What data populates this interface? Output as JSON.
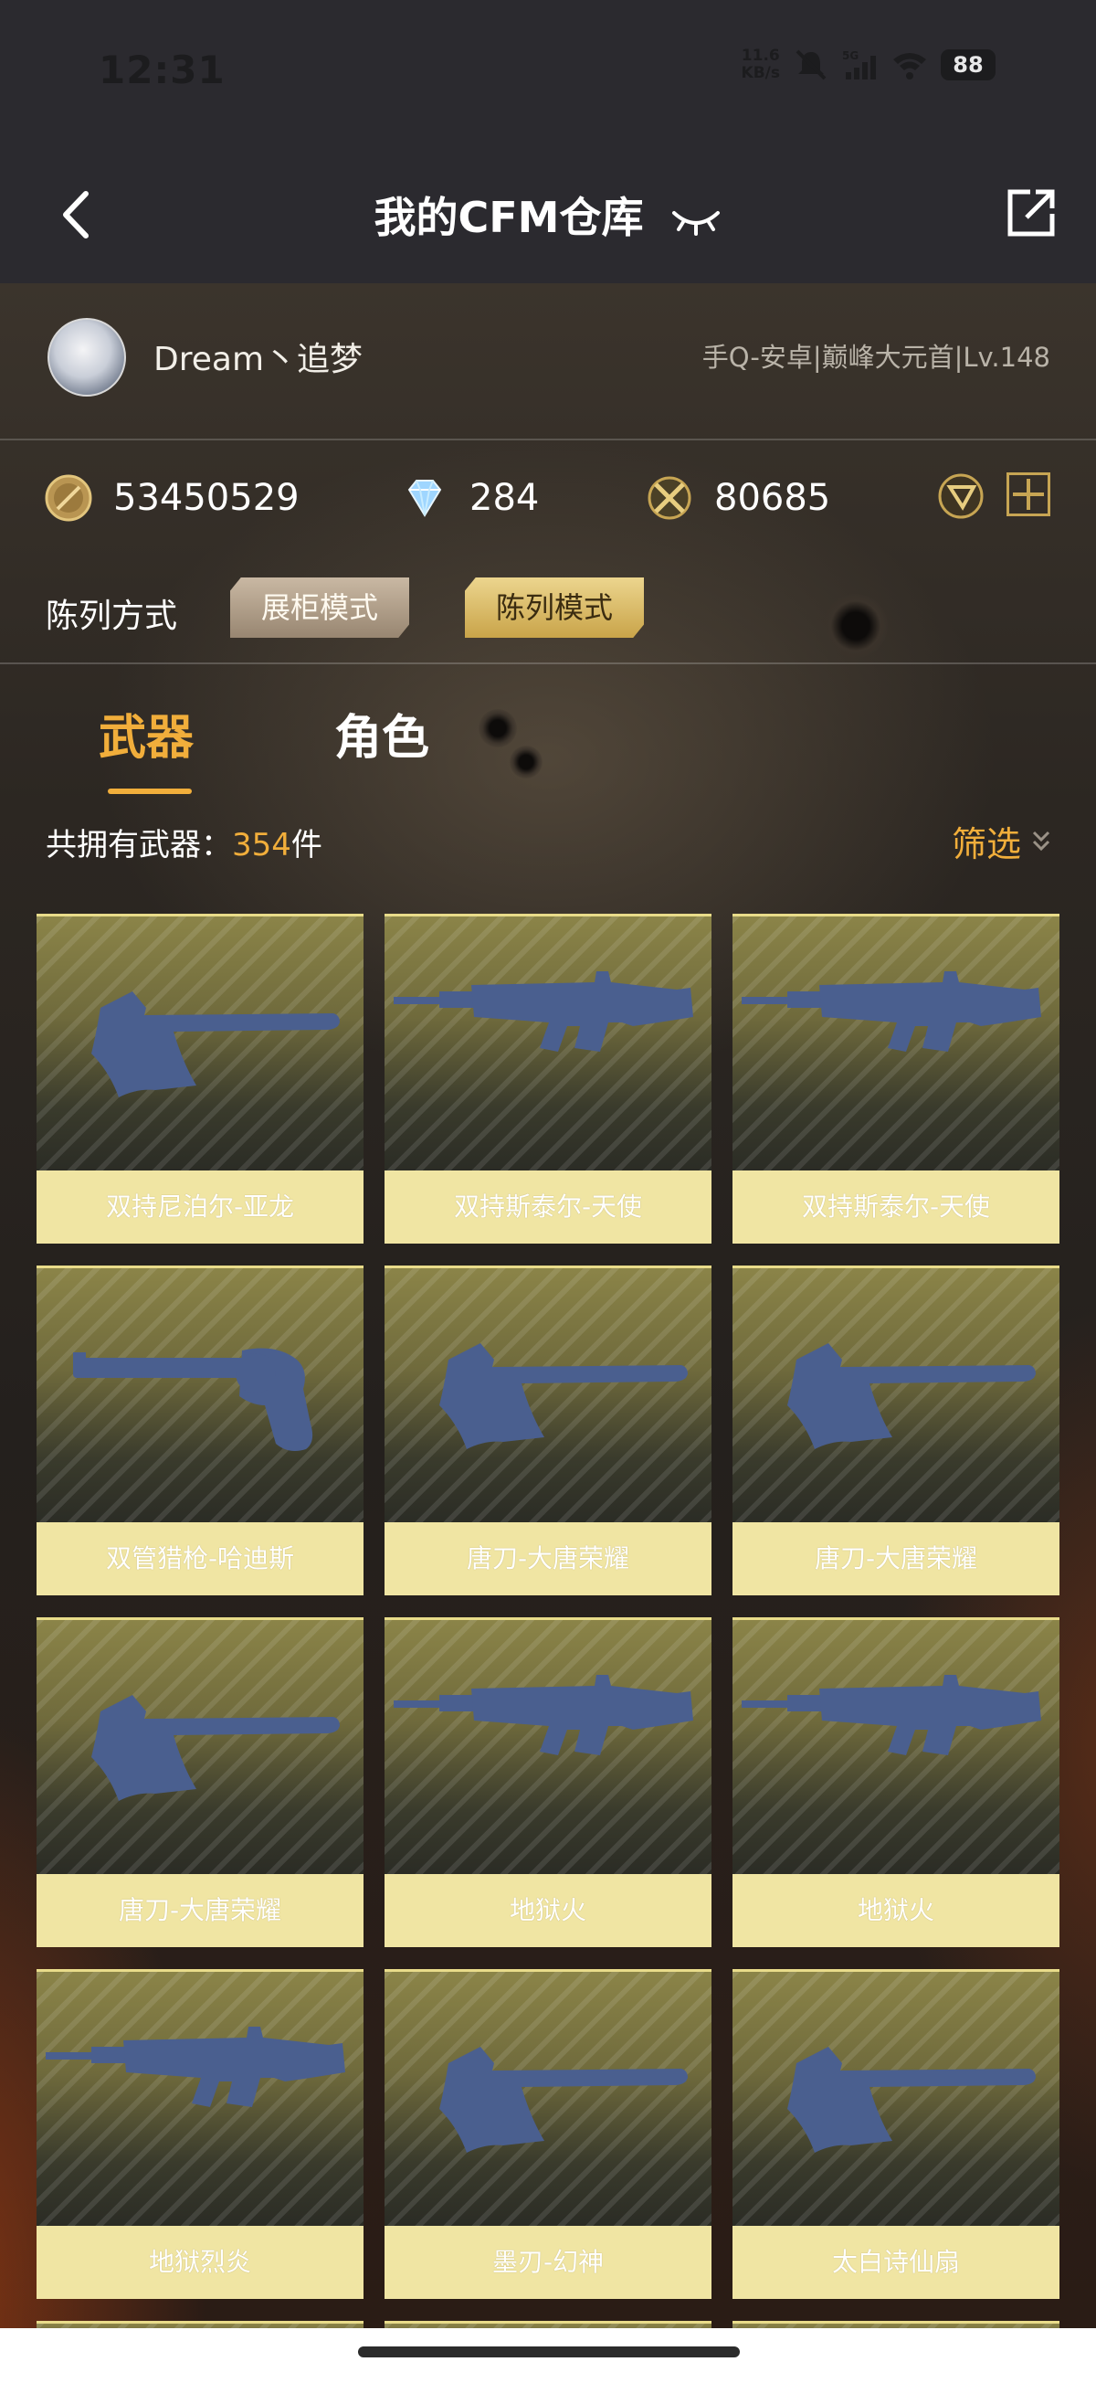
{
  "status_bar": {
    "time": "12:31",
    "net_speed_value": "11.6",
    "net_speed_unit": "KB/s",
    "network": "5G",
    "battery": "88"
  },
  "header": {
    "title": "我的CFM仓库"
  },
  "profile": {
    "username": "Dream丶追梦",
    "server_info": "手Q-安卓|巅峰大元首|Lv.148"
  },
  "currencies": {
    "gold": "53450529",
    "diamond": "284",
    "crossed_swords": "80685"
  },
  "display_mode": {
    "label": "陈列方式",
    "options": [
      "展柜模式",
      "陈列模式"
    ],
    "selected": "陈列模式"
  },
  "tabs": [
    {
      "label": "武器",
      "active": true
    },
    {
      "label": "角色",
      "active": false
    }
  ],
  "inventory": {
    "count_label": "共拥有武器：",
    "count_value": "354",
    "count_unit": "件",
    "filter_label": "筛选"
  },
  "weapons": [
    {
      "name": "双持尼泊尔-亚龙",
      "icon": "axe-icon"
    },
    {
      "name": "双持斯泰尔-天使",
      "icon": "rifle-icon"
    },
    {
      "name": "双持斯泰尔-天使",
      "icon": "rifle-icon"
    },
    {
      "name": "双管猎枪-哈迪斯",
      "icon": "revolver-icon"
    },
    {
      "name": "唐刀-大唐荣耀",
      "icon": "axe-icon"
    },
    {
      "name": "唐刀-大唐荣耀",
      "icon": "axe-icon"
    },
    {
      "name": "唐刀-大唐荣耀",
      "icon": "axe-icon"
    },
    {
      "name": "地狱火",
      "icon": "rifle-icon"
    },
    {
      "name": "地狱火",
      "icon": "rifle-icon"
    },
    {
      "name": "地狱烈炎",
      "icon": "rifle-icon"
    },
    {
      "name": "墨刃-幻神",
      "icon": "axe-icon"
    },
    {
      "name": "太白诗仙扇",
      "icon": "axe-icon"
    }
  ],
  "colors": {
    "accent": "#f1ae3b",
    "header_bg": "#2b2a2f",
    "card_label_bg": "#f0e5a3",
    "weapon_silhouette": "#4a5f8f"
  }
}
